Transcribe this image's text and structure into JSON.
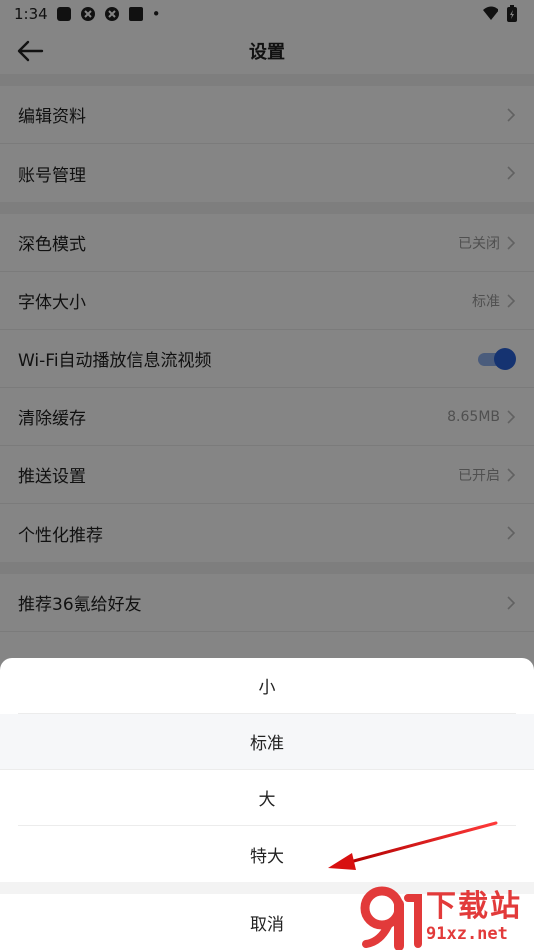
{
  "status_bar": {
    "time": "1:34",
    "dot": "•"
  },
  "header": {
    "title": "设置"
  },
  "settings": {
    "edit_profile": {
      "label": "编辑资料"
    },
    "account": {
      "label": "账号管理"
    },
    "dark_mode": {
      "label": "深色模式",
      "value": "已关闭"
    },
    "font_size": {
      "label": "字体大小",
      "value": "标准"
    },
    "wifi_autoplay": {
      "label": "Wi-Fi自动播放信息流视频",
      "on": true
    },
    "clear_cache": {
      "label": "清除缓存",
      "value": "8.65MB"
    },
    "push": {
      "label": "推送设置",
      "value": "已开启"
    },
    "personalized": {
      "label": "个性化推荐"
    },
    "recommend": {
      "label": "推荐36氪给好友"
    }
  },
  "font_sheet": {
    "options": [
      "小",
      "标准",
      "大",
      "特大"
    ],
    "selected": "标准",
    "cancel": "取消"
  },
  "watermark": {
    "brand": "下载站",
    "domain": "91xz.net"
  },
  "colors": {
    "accent": "#2a62d8",
    "annotation": "#e02020"
  }
}
